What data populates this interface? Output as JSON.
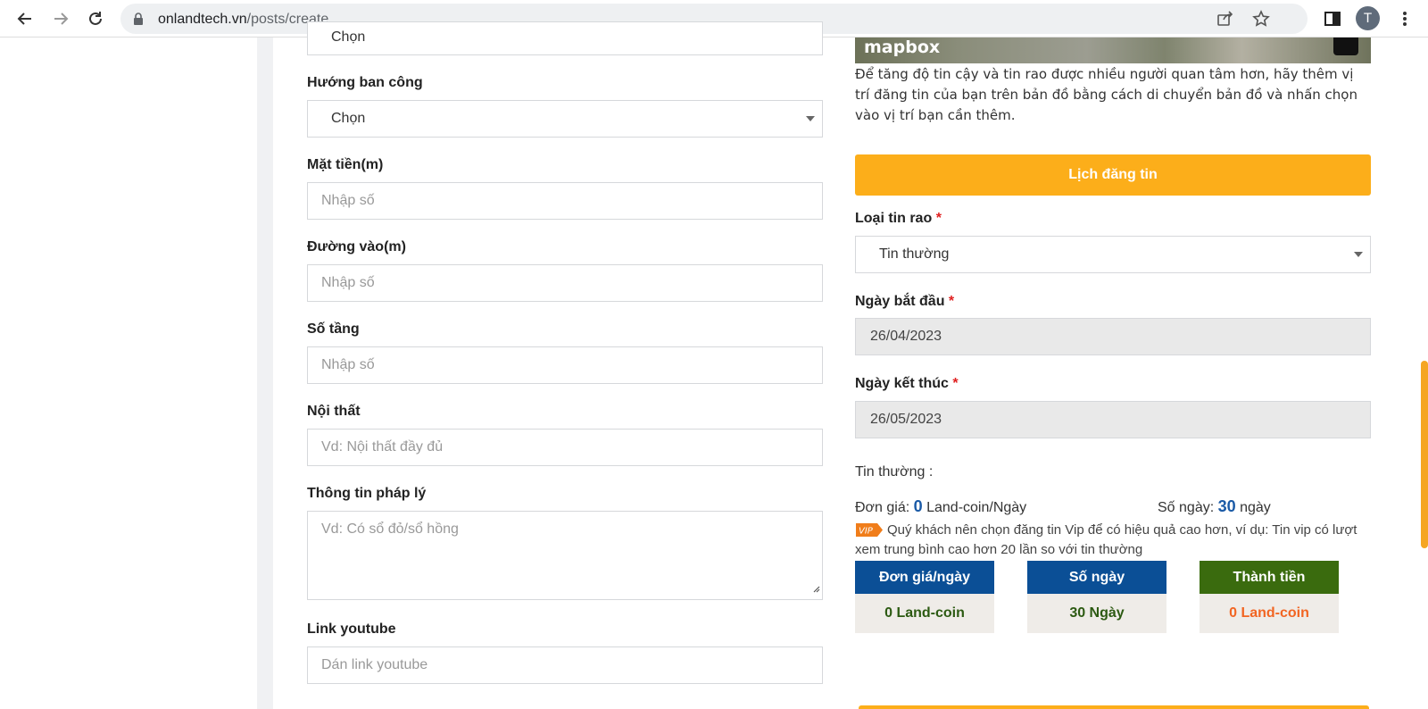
{
  "browser": {
    "url_domain": "onlandtech.vn",
    "url_path": "/posts/create",
    "avatar_letter": "T"
  },
  "left_form": {
    "top_select_partial": "Chọn",
    "balcony": {
      "label": "Hướng ban công",
      "value": "Chọn"
    },
    "frontage": {
      "label": "Mặt tiền(m)",
      "placeholder": "Nhập số"
    },
    "road": {
      "label": "Đường vào(m)",
      "placeholder": "Nhập số"
    },
    "floors": {
      "label": "Số tầng",
      "placeholder": "Nhập số"
    },
    "furniture": {
      "label": "Nội thất",
      "placeholder": "Vd: Nội thất đầy đủ"
    },
    "legal": {
      "label": "Thông tin pháp lý",
      "placeholder": "Vd: Có sổ đỏ/sổ hồng"
    },
    "youtube": {
      "label": "Link youtube",
      "placeholder": "Dán link youtube"
    }
  },
  "map": {
    "logo": "mapbox",
    "note": "Để tăng độ tin cậy và tin rao được nhiều người quan tâm hơn, hãy thêm vị trí đăng tin của bạn trên bản đồ bằng cách di chuyển bản đồ và nhấn chọn vào vị trí bạn cần thêm."
  },
  "schedule": {
    "header": "Lịch đăng tin",
    "type_label": "Loại tin rao",
    "type_value": "Tin thường",
    "start_label": "Ngày bắt đầu",
    "start_value": "26/04/2023",
    "end_label": "Ngày kết thúc",
    "end_value": "26/05/2023",
    "required_mark": "*"
  },
  "summary": {
    "type_line": "Tin thường :",
    "unit_price_label": "Đơn giá:",
    "unit_price_value": "0",
    "unit_price_unit": "Land-coin/Ngày",
    "days_label": "Số ngày:",
    "days_value": "30",
    "days_unit": "ngày",
    "vip_badge": "VIP",
    "vip_text": "Quý khách nên chọn đăng tin Vip để có hiệu quả cao hơn, ví dụ: Tin vip có lượt xem trung bình cao hơn 20 lần so với tin thường"
  },
  "tiles": [
    {
      "head": "Đơn giá/ngày",
      "value": "0 Land-coin",
      "head_color": "#0b4f96",
      "value_color": "#2c5a12"
    },
    {
      "head": "Số ngày",
      "value": "30 Ngày",
      "head_color": "#0b4f96",
      "value_color": "#2c5a12"
    },
    {
      "head": "Thành tiền",
      "value": "0 Land-coin",
      "head_color": "#3a6b0e",
      "value_color": "#f26522"
    }
  ],
  "colors": {
    "accent": "#fcae1a",
    "required": "#e02020",
    "number": "#1a5aa6"
  }
}
